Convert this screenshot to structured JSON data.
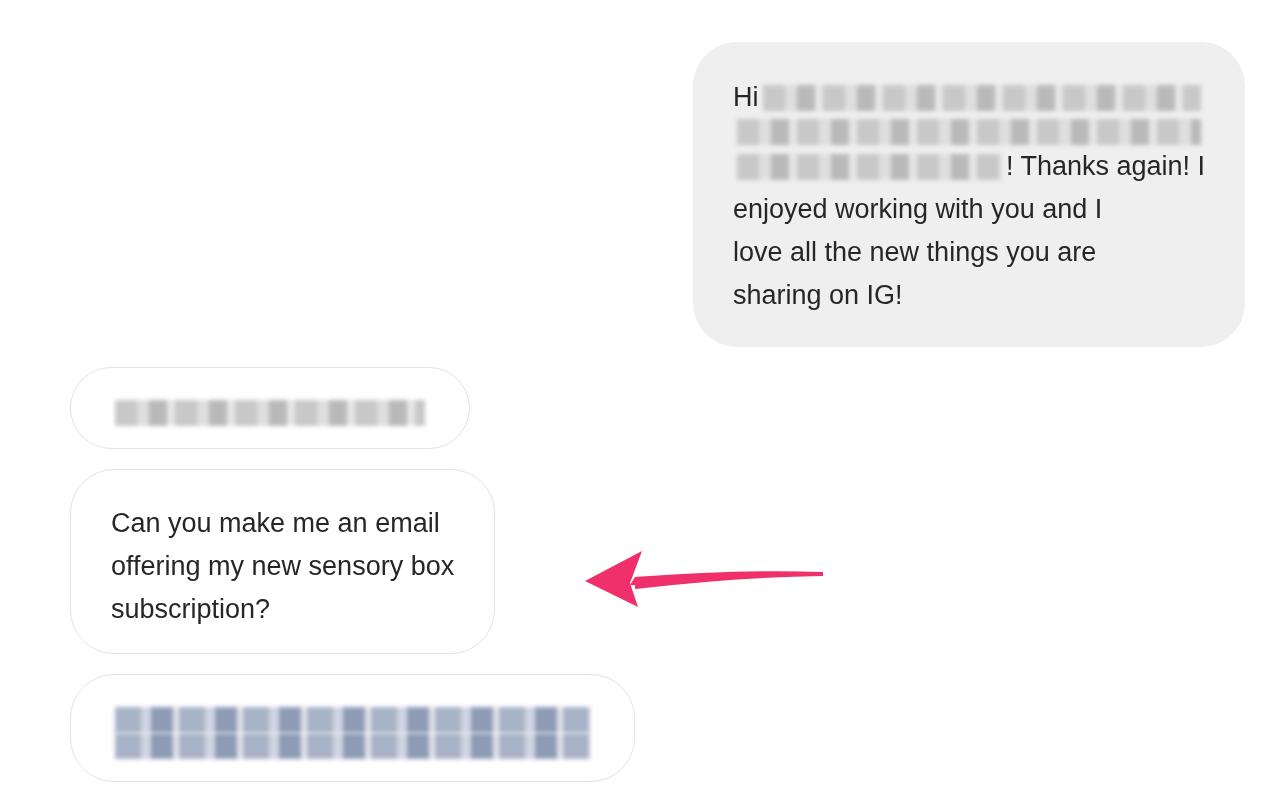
{
  "messages": [
    {
      "kind": "outgoing",
      "lines": [
        [
          {
            "kind": "text",
            "text": "Hi"
          },
          {
            "kind": "blur"
          }
        ],
        [
          {
            "kind": "blur"
          }
        ],
        [
          {
            "kind": "blur"
          },
          {
            "kind": "text",
            "text": "! Thanks again! I"
          }
        ],
        [
          {
            "kind": "text",
            "text": "enjoyed working with you and I"
          }
        ],
        [
          {
            "kind": "text",
            "text": "love all the new things you are"
          }
        ],
        [
          {
            "kind": "text",
            "text": "sharing on IG!"
          }
        ]
      ]
    },
    {
      "kind": "incoming",
      "lines": [
        [
          {
            "kind": "blur"
          }
        ]
      ]
    },
    {
      "kind": "incoming",
      "lines": [
        [
          {
            "kind": "text",
            "text": "Can you make me an email"
          }
        ],
        [
          {
            "kind": "text",
            "text": "offering my new sensory box"
          }
        ],
        [
          {
            "kind": "text",
            "text": "subscription?"
          }
        ]
      ]
    },
    {
      "kind": "incoming",
      "lines": [
        [
          {
            "kind": "blur-wide"
          }
        ],
        [
          {
            "kind": "blur-wide"
          }
        ]
      ]
    }
  ]
}
